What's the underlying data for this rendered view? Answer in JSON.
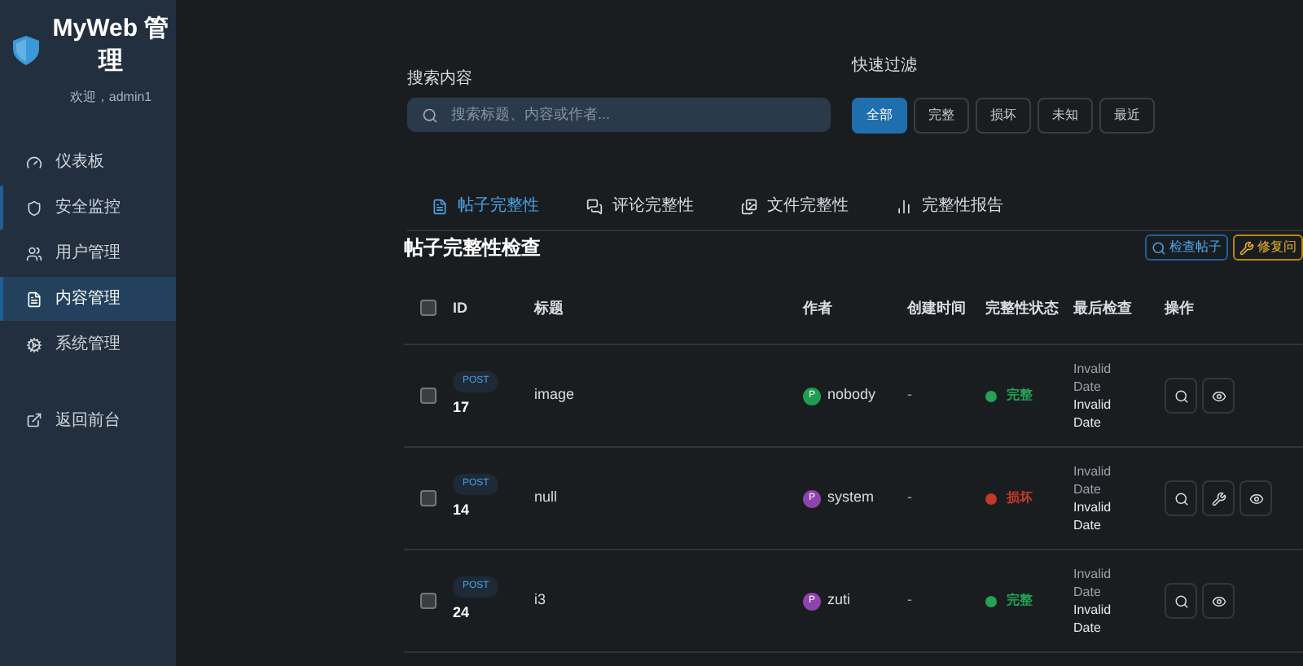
{
  "sidebar": {
    "brand": "MyWeb 管理",
    "welcome": "欢迎，admin1",
    "items": [
      {
        "label": "仪表板",
        "selected": false,
        "marked": false
      },
      {
        "label": "安全监控",
        "selected": false,
        "marked": true
      },
      {
        "label": "用户管理",
        "selected": false,
        "marked": false
      },
      {
        "label": "内容管理",
        "selected": true,
        "marked": true
      },
      {
        "label": "系统管理",
        "selected": false,
        "marked": false
      }
    ],
    "footer_link": "返回前台"
  },
  "search": {
    "label": "搜索内容",
    "placeholder": "搜索标题、内容或作者..."
  },
  "quick_filter": {
    "label": "快速过滤",
    "options": [
      {
        "label": "全部",
        "selected": true
      },
      {
        "label": "完整",
        "selected": false
      },
      {
        "label": "损坏",
        "selected": false
      },
      {
        "label": "未知",
        "selected": false
      },
      {
        "label": "最近",
        "selected": false
      }
    ]
  },
  "tabs": [
    {
      "label": "帖子完整性",
      "selected": true
    },
    {
      "label": "评论完整性",
      "selected": false
    },
    {
      "label": "文件完整性",
      "selected": false
    },
    {
      "label": "完整性报告",
      "selected": false
    }
  ],
  "section": {
    "title": "帖子完整性检查",
    "buttons": [
      {
        "kind": "check",
        "label": "检查帖子"
      },
      {
        "kind": "repair",
        "label": "修复问"
      }
    ]
  },
  "table": {
    "select_all_checked": false,
    "columns": [
      "ID",
      "标题",
      "作者",
      "创建时间",
      "完整性状态",
      "最后检查",
      "操作"
    ],
    "rows": [
      {
        "checked": false,
        "type": "POST",
        "id": "17",
        "title": "image",
        "avatar": "P",
        "author": "nobody",
        "color": "#1e9e4e",
        "created": "-",
        "status": {
          "label": "完整",
          "kind": "ok"
        },
        "last_check": [
          "Invalid Date",
          "Invalid Date"
        ],
        "actions": [
          {
            "kind": "search"
          },
          {
            "kind": "view"
          }
        ]
      },
      {
        "checked": false,
        "type": "POST",
        "id": "14",
        "title": "null",
        "avatar": "P",
        "author": "system",
        "color": "#8e44ad",
        "created": "-",
        "status": {
          "label": "损坏",
          "kind": "broken"
        },
        "last_check": [
          "Invalid Date",
          "Invalid Date"
        ],
        "actions": [
          {
            "kind": "search"
          },
          {
            "kind": "repair"
          },
          {
            "kind": "view"
          }
        ]
      },
      {
        "checked": false,
        "type": "POST",
        "id": "24",
        "title": "i3",
        "avatar": "P",
        "author": "zuti",
        "color": "#8e44ad",
        "created": "-",
        "status": {
          "label": "完整",
          "kind": "ok"
        },
        "last_check": [
          "Invalid Date",
          "Invalid Date"
        ],
        "actions": [
          {
            "kind": "search"
          },
          {
            "kind": "view"
          }
        ]
      }
    ]
  }
}
